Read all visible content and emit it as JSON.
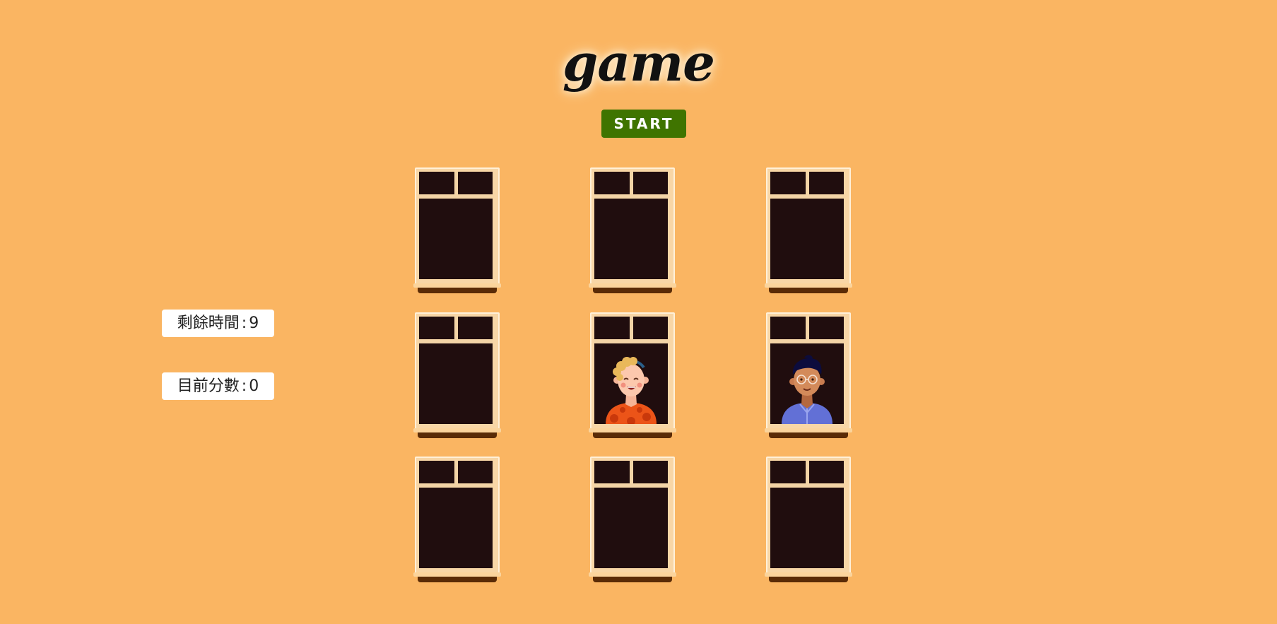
{
  "title": "game",
  "start_button": "START",
  "remaining_time": {
    "label": "剩餘時間",
    "separator": ":",
    "value": "9"
  },
  "current_score": {
    "label": "目前分數",
    "separator": ":",
    "value": "0"
  },
  "colors": {
    "background": "#fab562",
    "start_button": "#3f7400",
    "window_glass": "#200d0e",
    "window_frame": "#f8d6a6",
    "window_sill": "#5a2b06"
  },
  "windows": [
    {
      "row": 1,
      "col": 1,
      "occupant": "empty"
    },
    {
      "row": 1,
      "col": 2,
      "occupant": "empty"
    },
    {
      "row": 1,
      "col": 3,
      "occupant": "empty"
    },
    {
      "row": 2,
      "col": 1,
      "occupant": "empty"
    },
    {
      "row": 2,
      "col": 2,
      "occupant": "woman-character"
    },
    {
      "row": 2,
      "col": 3,
      "occupant": "man-with-glasses-character"
    },
    {
      "row": 3,
      "col": 1,
      "occupant": "empty"
    },
    {
      "row": 3,
      "col": 2,
      "occupant": "empty"
    },
    {
      "row": 3,
      "col": 3,
      "occupant": "empty"
    }
  ]
}
